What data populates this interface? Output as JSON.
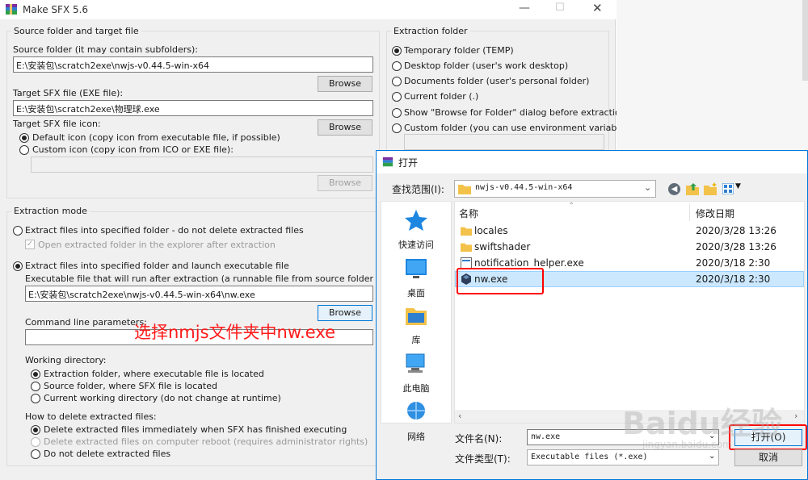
{
  "sfx": {
    "window_title": "Make SFX 5.6",
    "source_group_title": "Source folder and target file",
    "source_folder_label": "Source folder (it may contain subfolders):",
    "source_folder_value": "E:\\安装包\\scratch2exe\\nwjs-v0.44.5-win-x64",
    "browse_label": "Browse",
    "target_label": "Target SFX file (EXE file):",
    "target_value": "E:\\安装包\\scratch2exe\\物理球.exe",
    "icon_label": "Target SFX file icon:",
    "default_icon_label": "Default icon (copy icon from executable file, if possible)",
    "custom_icon_label": "Custom icon (copy icon from ICO or EXE file):",
    "extraction_group_title": "Extraction folder",
    "folder_options": [
      "Temporary folder (TEMP)",
      "Desktop folder (user's work desktop)",
      "Documents folder (user's personal folder)",
      "Current folder (.)",
      "Show \"Browse for Folder\" dialog before extraction",
      "Custom folder (you can use environment variables):"
    ],
    "mode_group_title": "Extraction mode",
    "mode_extract_only": "Extract files into specified folder - do not delete extracted files",
    "open_folder_label": "Open extracted folder in the explorer after extraction",
    "mode_extract_launch": "Extract files into specified folder and launch executable file",
    "exec_label": "Executable file that will run after extraction (a runnable file from source folder or subfolders):",
    "exec_value": "E:\\安装包\\scratch2exe\\nwjs-v0.44.5-win-x64\\nw.exe",
    "cmdline_label": "Command line parameters:",
    "workdir_label": "Working directory:",
    "workdir_options": [
      "Extraction folder, where executable file is located",
      "Source folder, where SFX file is located",
      "Current working directory (do not change at runtime)"
    ],
    "delete_label": "How to delete extracted files:",
    "delete_options": [
      "Delete extracted files immediately when SFX has finished executing",
      "Delete extracted files on computer reboot (requires administrator rights)",
      "Do not delete extracted files"
    ]
  },
  "annotation": {
    "text": "选择nmjs文件夹中nw.exe",
    "color": "#ff1a1a"
  },
  "dialog": {
    "title": "打开",
    "lookin_label": "查找范围(I):",
    "lookin_value": "nwjs-v0.44.5-win-x64",
    "col_name": "名称",
    "col_date": "修改日期",
    "nav": [
      "快速访问",
      "桌面",
      "库",
      "此电脑",
      "网络"
    ],
    "files": [
      {
        "name": "locales",
        "date": "2020/3/28 13:26",
        "type": "folder"
      },
      {
        "name": "swiftshader",
        "date": "2020/3/28 13:26",
        "type": "folder"
      },
      {
        "name": "notification_helper.exe",
        "date": "2020/3/18 2:30",
        "type": "exe"
      },
      {
        "name": "nw.exe",
        "date": "2020/3/18 2:30",
        "type": "nw"
      }
    ],
    "filename_label": "文件名(N):",
    "filename_value": "nw.exe",
    "filetype_label": "文件类型(T):",
    "filetype_value": "Executable files (*.exe)",
    "open_label": "打开(O)",
    "cancel_label": "取消"
  },
  "watermark": {
    "brand": "Baidu经验",
    "url": "jingyan.baidu.com"
  },
  "colors": {
    "accent": "#0078d7",
    "highlight_box": "#ff0000",
    "selection": "#cce8ff"
  }
}
